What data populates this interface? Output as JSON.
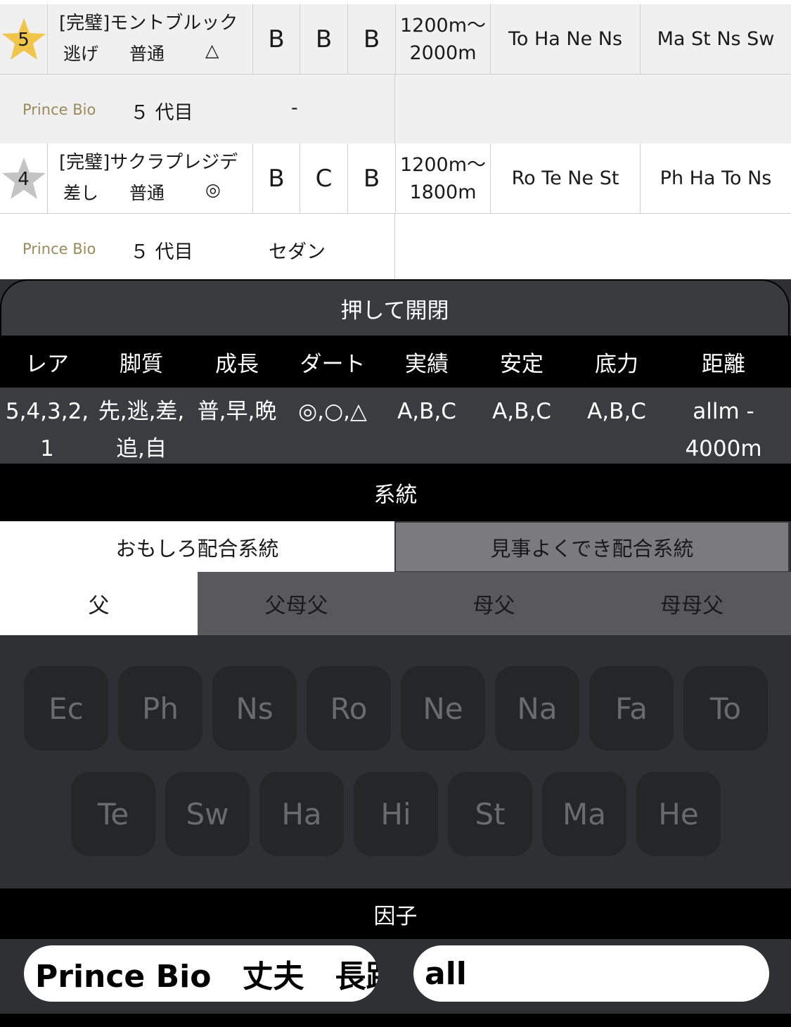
{
  "horses": [
    {
      "rank": "5",
      "star_color": "#f0c54a",
      "name": "[完璧]モントブルック",
      "style": "逃げ",
      "growth": "普通",
      "dirt": "△",
      "grades": [
        "B",
        "B",
        "B"
      ],
      "dist_from": "1200m〜",
      "dist_to": "2000m",
      "lines1": "To Ha Ne Ns",
      "lines2": "Ma St Ns Sw",
      "owner": "Prince Bio",
      "generation": "５ 代目",
      "car": "-"
    },
    {
      "rank": "4",
      "star_color": "#c4c4c4",
      "name": "[完璧]サクラプレジデ",
      "style": "差し",
      "growth": "普通",
      "dirt": "◎",
      "grades": [
        "B",
        "C",
        "B"
      ],
      "dist_from": "1200m〜",
      "dist_to": "1800m",
      "lines1": "Ro Te Ne St",
      "lines2": "Ph Ha To Ns",
      "owner": "Prince Bio",
      "generation": "５ 代目",
      "car": "セダン"
    }
  ],
  "panel": {
    "toggle_label": "押して開閉",
    "headers": [
      "レア",
      "脚質",
      "成長",
      "ダート",
      "実績",
      "安定",
      "底力",
      "距離"
    ],
    "values": {
      "rare": "5,4,3,2,",
      "rare2": "1",
      "style": "先,逃,差,",
      "style2": "追,自",
      "growth": "普,早,晩",
      "dirt": "◎,○,△",
      "record": "A,B,C",
      "stable": "A,B,C",
      "power": "A,B,C",
      "distance": "allm -",
      "distance2": "4000m"
    },
    "lineage_title": "系統",
    "lineage_tabs": [
      "おもしろ配合系統",
      "見事よくでき配合系統"
    ],
    "pedigree_tabs": [
      "父",
      "父母父",
      "母父",
      "母母父"
    ],
    "lineage_keys_row1": [
      "Ec",
      "Ph",
      "Ns",
      "Ro",
      "Ne",
      "Na",
      "Fa",
      "To"
    ],
    "lineage_keys_row2": [
      "Te",
      "Sw",
      "Ha",
      "Hi",
      "St",
      "Ma",
      "He"
    ],
    "factor_title": "因子",
    "factor_input": "Prince Bio　丈夫　長距離",
    "distance_input": "all"
  }
}
